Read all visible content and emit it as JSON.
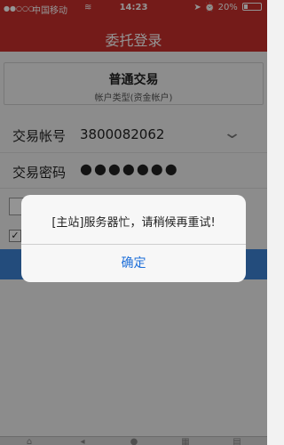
{
  "status_bar": {
    "carrier": "中国移动",
    "time": "14:23",
    "battery_percent_text": "20%",
    "battery_level": 0.2
  },
  "nav": {
    "title": "委托登录"
  },
  "trade_type": {
    "title": "普通交易",
    "subtitle": "帐户类型(资金帐户)"
  },
  "form": {
    "account_label": "交易帐号",
    "account_value": "3800082062",
    "password_label": "交易密码",
    "password_value": "●●●●●●●"
  },
  "dialog": {
    "message": "[主站]服务器忙，请稍候再重试!",
    "ok_label": "确定"
  },
  "colors": {
    "nav_bar": "#c9302c",
    "accent_blue": "#3d84d6",
    "dialog_button": "#1e6fd9"
  }
}
